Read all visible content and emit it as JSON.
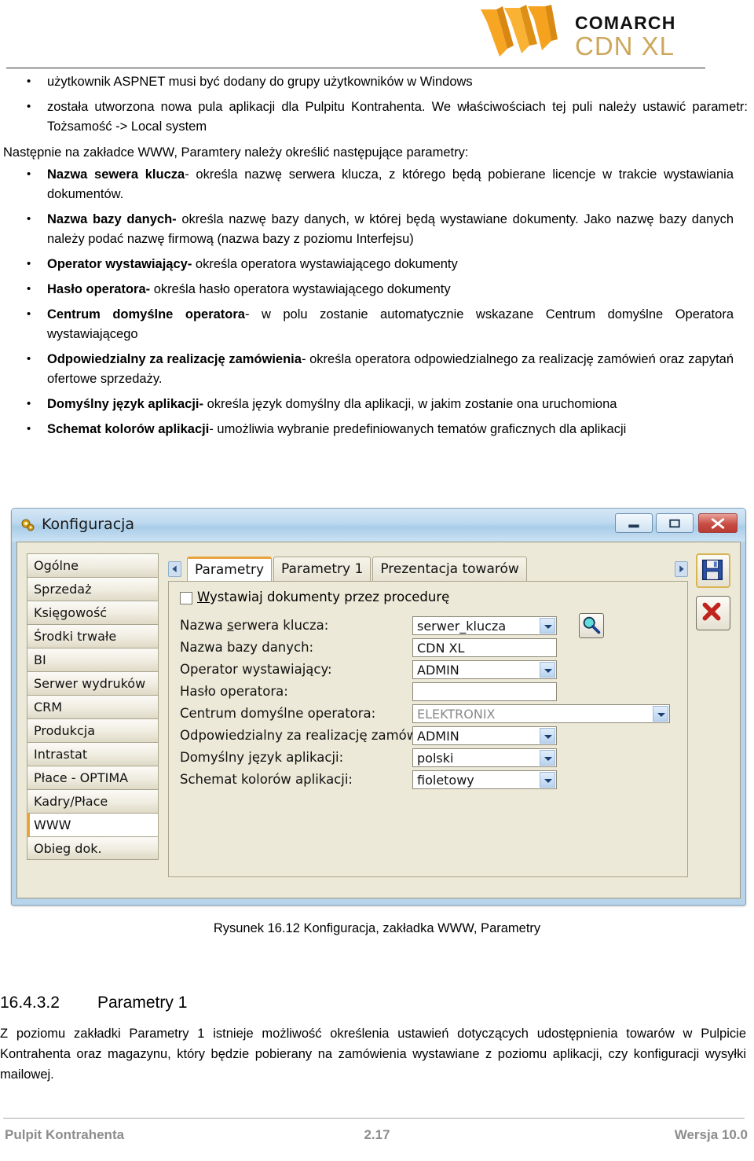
{
  "logo": {
    "brand": "COMARCH",
    "product": "CDN XL",
    "mark_icon": "comarch-w-mark",
    "colors": {
      "mark": "#f5a21e",
      "brand": "#111111",
      "product": "#cda85c"
    }
  },
  "top_bullets": [
    "użytkownik ASPNET musi być dodany do grupy użytkowników w Windows",
    "została utworzona nowa pula aplikacji dla Pulpitu Kontrahenta. We właściwościach tej puli należy ustawić parametr: Tożsamość -> Local system"
  ],
  "intro_line": "Następnie na zakładce WWW, Paramtery należy określić następujące parametry:",
  "param_bullets": [
    {
      "term": "Nazwa sewera klucza",
      "desc": "- określa nazwę serwera klucza, z którego będą pobierane licencje w trakcie wystawiania dokumentów."
    },
    {
      "term": "Nazwa bazy danych-",
      "desc": " określa nazwę bazy danych, w której będą wystawiane dokumenty. Jako nazwę bazy danych należy podać nazwę firmową (nazwa bazy z poziomu Interfejsu)"
    },
    {
      "term": "Operator wystawiający-",
      "desc": " określa operatora wystawiającego dokumenty"
    },
    {
      "term": "Hasło operatora-",
      "desc": " określa hasło operatora wystawiającego dokumenty"
    },
    {
      "term": "Centrum domyślne operatora",
      "desc": "- w polu zostanie automatycznie wskazane Centrum domyślne Operatora wystawiającego"
    },
    {
      "term": "Odpowiedzialny za realizację zamówienia",
      "desc": "- określa operatora odpowiedzialnego za realizację zamówień oraz zapytań ofertowe sprzedaży."
    },
    {
      "term": "Domyślny język aplikacji-",
      "desc": " określa język domyślny dla aplikacji, w jakim zostanie ona uruchomiona"
    },
    {
      "term": "Schemat kolorów aplikacji",
      "desc": "- umożliwia wybranie predefiniowanych tematów graficznych dla aplikacji"
    }
  ],
  "dialog": {
    "title": "Konfiguracja",
    "title_icon": "gear-icon",
    "caption_buttons": {
      "minimize": "minimize-icon",
      "maximize": "maximize-icon",
      "close": "close-icon"
    },
    "sidebar": [
      "Ogólne",
      "Sprzedaż",
      "Księgowość",
      "Środki trwałe",
      "BI",
      "Serwer wydruków",
      "CRM",
      "Produkcja",
      "Intrastat",
      "Płace - OPTIMA",
      "Kadry/Płace",
      "WWW",
      "Obieg dok."
    ],
    "sidebar_selected": "WWW",
    "tabs": [
      "Parametry",
      "Parametry 1",
      "Prezentacja towarów"
    ],
    "active_tab": "Parametry",
    "scroll_left_icon": "chevron-left-icon",
    "scroll_right_icon": "chevron-right-icon",
    "checkbox": {
      "label": "Wystawiaj dokumenty przez procedurę",
      "mnemonic": "W",
      "checked": false
    },
    "fields": [
      {
        "label": "Nazwa serwera klucza:",
        "mnemonic": "s",
        "value": "serwer_klucza",
        "type": "combo",
        "disabled": false
      },
      {
        "label": "Nazwa bazy danych:",
        "value": "CDN XL",
        "type": "text",
        "disabled": false
      },
      {
        "label": "Operator wystawiający:",
        "value": "ADMIN",
        "type": "combo",
        "disabled": false
      },
      {
        "label": "Hasło operatora:",
        "value": "",
        "type": "text",
        "disabled": false
      },
      {
        "label": "Centrum domyślne operatora:",
        "value": "ELEKTRONIX",
        "type": "combo",
        "disabled": true
      },
      {
        "label": "Odpowiedzialny za realizację zamówienia:",
        "value": "ADMIN",
        "type": "combo",
        "disabled": false
      },
      {
        "label": "Domyślny język aplikacji:",
        "value": "polski",
        "type": "combo",
        "disabled": false
      },
      {
        "label": "Schemat kolorów aplikacji:",
        "value": "fioletowy",
        "type": "combo",
        "disabled": false
      }
    ],
    "search_button_icon": "magnifier-icon",
    "tools": [
      {
        "icon": "floppy-save-icon",
        "name": "save"
      },
      {
        "icon": "red-x-cancel-icon",
        "name": "cancel"
      }
    ]
  },
  "figure_caption": "Rysunek 16.12 Konfiguracja, zakładka WWW, Parametry",
  "section": {
    "number": "16.4.3.2",
    "title": "Parametry 1",
    "body": "Z poziomu zakładki Parametry 1 istnieje możliwość określenia ustawień dotyczących udostępnienia towarów w Pulpicie Kontrahenta oraz magazynu, który będzie pobierany na zamówienia wystawiane z poziomu aplikacji, czy konfiguracji wysyłki mailowej."
  },
  "footer": {
    "left": "Pulpit Kontrahenta",
    "center": "2.17",
    "right": "Wersja 10.0"
  }
}
